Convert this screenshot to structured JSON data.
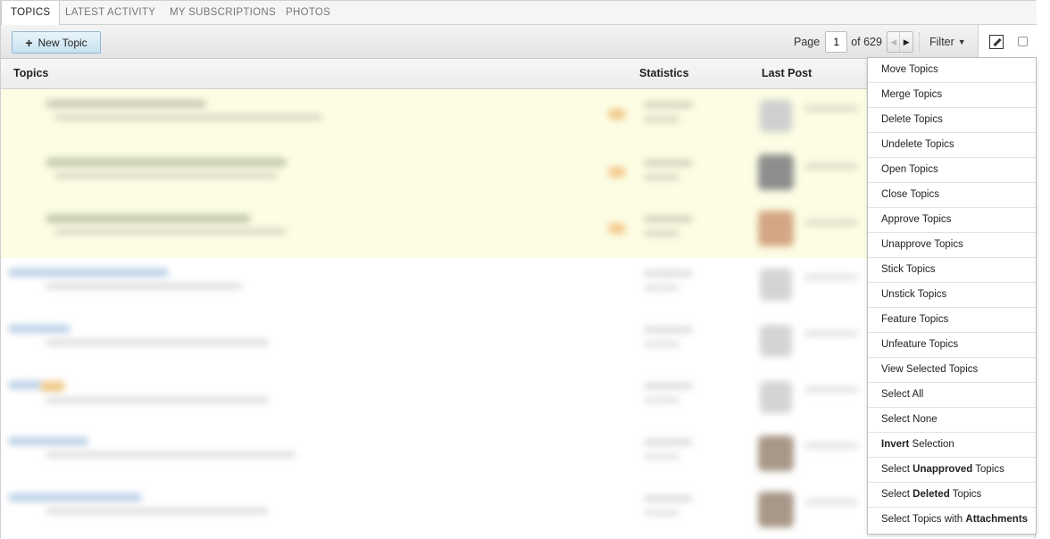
{
  "tabs": [
    {
      "label": "Topics",
      "active": true
    },
    {
      "label": "Latest Activity",
      "active": false
    },
    {
      "label": "My Subscriptions",
      "active": false
    },
    {
      "label": "Photos",
      "active": false
    }
  ],
  "toolbar": {
    "new_topic_label": "New Topic",
    "page_label": "Page",
    "page_value": "1",
    "page_total": "of 629",
    "filter_label": "Filter"
  },
  "table_headers": {
    "topics": "Topics",
    "statistics": "Statistics",
    "last_post": "Last Post"
  },
  "moderation_menu": {
    "items": [
      {
        "pre": "Move Topics",
        "bold": "",
        "post": ""
      },
      {
        "pre": "Merge Topics",
        "bold": "",
        "post": ""
      },
      {
        "pre": "Delete Topics",
        "bold": "",
        "post": ""
      },
      {
        "pre": "Undelete Topics",
        "bold": "",
        "post": ""
      },
      {
        "pre": "Open Topics",
        "bold": "",
        "post": ""
      },
      {
        "pre": "Close Topics",
        "bold": "",
        "post": ""
      },
      {
        "pre": "Approve Topics",
        "bold": "",
        "post": ""
      },
      {
        "pre": "Unapprove Topics",
        "bold": "",
        "post": ""
      },
      {
        "pre": "Stick Topics",
        "bold": "",
        "post": ""
      },
      {
        "pre": "Unstick Topics",
        "bold": "",
        "post": ""
      },
      {
        "pre": "Feature Topics",
        "bold": "",
        "post": ""
      },
      {
        "pre": "Unfeature Topics",
        "bold": "",
        "post": ""
      },
      {
        "pre": "View Selected Topics",
        "bold": "",
        "post": ""
      },
      {
        "pre": "Select All",
        "bold": "",
        "post": ""
      },
      {
        "pre": "Select None",
        "bold": "",
        "post": ""
      },
      {
        "pre": "",
        "bold": "Invert",
        "post": " Selection"
      },
      {
        "pre": "Select ",
        "bold": "Unapproved",
        "post": " Topics"
      },
      {
        "pre": "Select ",
        "bold": "Deleted",
        "post": " Topics"
      },
      {
        "pre": "Select Topics with ",
        "bold": "Attachments",
        "post": ""
      }
    ]
  },
  "colors": {
    "highlight_row": "#fcfde4",
    "button_border": "#92b8cf",
    "link_blue": "#3a7fc0"
  },
  "icons": {
    "new_topic": "plus-icon",
    "pager_prev": "triangle-left-icon",
    "pager_next": "triangle-right-icon",
    "filter": "caret-down-icon",
    "moderation": "edit-pencil-icon"
  }
}
